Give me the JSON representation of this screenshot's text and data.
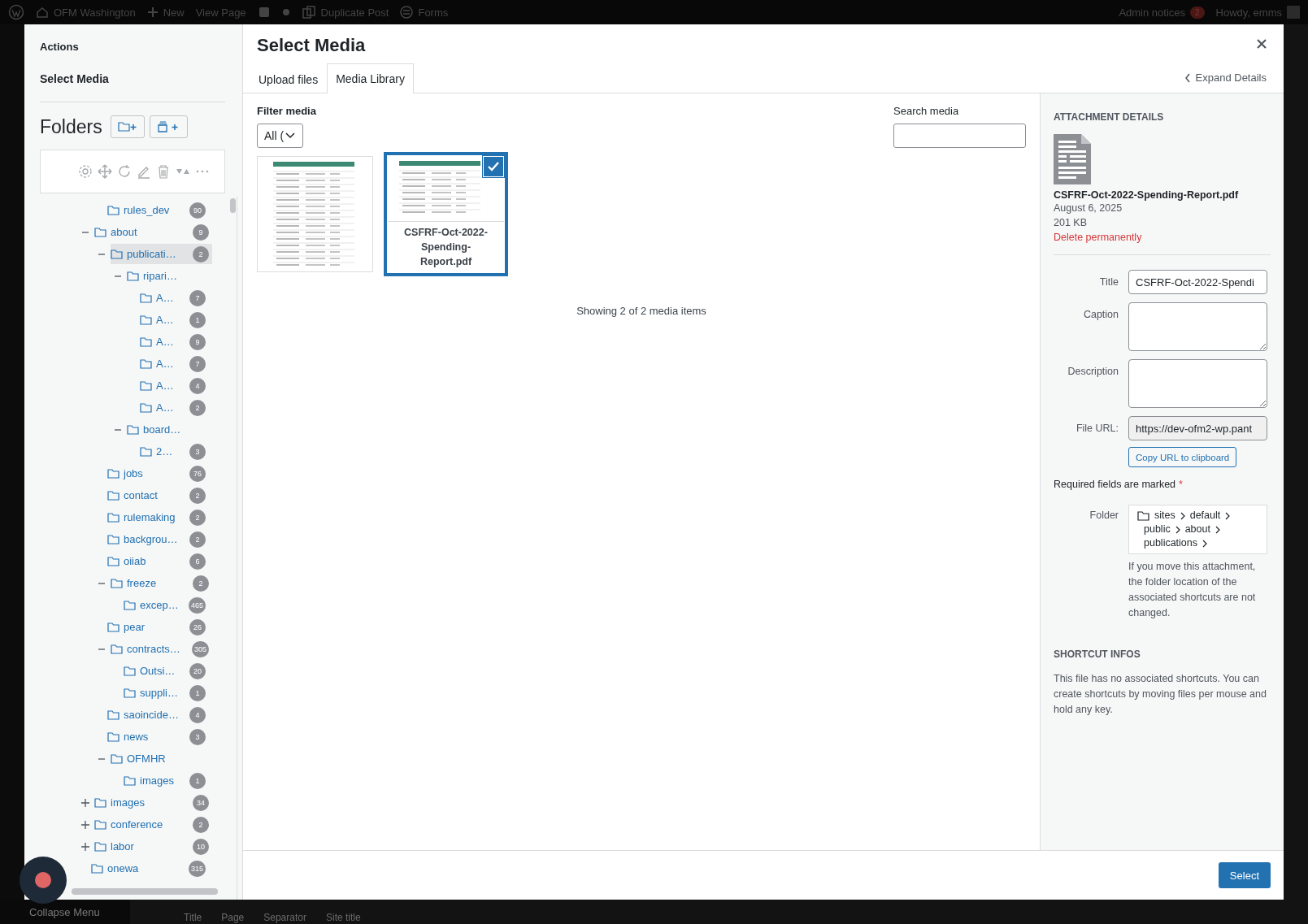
{
  "admin_bar": {
    "site": "OFM Washington",
    "new": "New",
    "view_page": "View Page",
    "duplicate": "Duplicate Post",
    "forms": "Forms",
    "notices": "Admin notices",
    "notices_count": "2",
    "greeting": "Howdy, emms"
  },
  "background": {
    "collapse_menu": "Collapse Menu",
    "columns": [
      "Title",
      "Page",
      "Separator",
      "Site title"
    ]
  },
  "sidebar": {
    "actions": "Actions",
    "select_media": "Select Media",
    "folders_heading": "Folders",
    "tree": [
      {
        "children": [
          {
            "label": "rules_dev",
            "count": "90",
            "selected": false
          }
        ]
      },
      {
        "label": "about",
        "count": "9",
        "selected": false,
        "expanded": true,
        "children": [
          {
            "label": "publicati…",
            "count": "2",
            "selected": true,
            "expanded": true,
            "children": [
              {
                "label": "ripari…",
                "selected": false,
                "expanded": true,
                "children": [
                  {
                    "label": "A…",
                    "count": "7",
                    "selected": false
                  },
                  {
                    "label": "A…",
                    "count": "1",
                    "selected": false
                  },
                  {
                    "label": "A…",
                    "count": "9",
                    "selected": false
                  },
                  {
                    "label": "A…",
                    "count": "7",
                    "selected": false
                  },
                  {
                    "label": "A…",
                    "count": "4",
                    "selected": false
                  },
                  {
                    "label": "A…",
                    "count": "2",
                    "selected": false
                  }
                ]
              },
              {
                "label": "board…",
                "selected": false,
                "expanded": true,
                "children": [
                  {
                    "label": "2…",
                    "count": "3",
                    "selected": false
                  }
                ]
              }
            ]
          },
          {
            "label": "jobs",
            "count": "76",
            "selected": false
          },
          {
            "label": "contact",
            "count": "2",
            "selected": false
          },
          {
            "label": "rulemaking",
            "count": "2",
            "selected": false
          },
          {
            "label": "backgrou…",
            "count": "2",
            "selected": false
          },
          {
            "label": "oiiab",
            "count": "6",
            "selected": false
          },
          {
            "label": "freeze",
            "count": "2",
            "selected": false,
            "expanded": true,
            "children": [
              {
                "label": "excep…",
                "count": "465",
                "selected": false
              }
            ]
          },
          {
            "label": "pear",
            "count": "26",
            "selected": false
          },
          {
            "label": "contracts…",
            "count": "305",
            "selected": false,
            "expanded": true,
            "children": [
              {
                "label": "Outsi…",
                "count": "20",
                "selected": false
              },
              {
                "label": "suppli…",
                "count": "1",
                "selected": false
              }
            ]
          },
          {
            "label": "saoincide…",
            "count": "4",
            "selected": false
          },
          {
            "label": "news",
            "count": "3",
            "selected": false
          },
          {
            "label": "OFMHR",
            "selected": false,
            "expanded": true,
            "children": [
              {
                "label": "images",
                "count": "1",
                "selected": false
              }
            ]
          }
        ]
      },
      {
        "label": "images",
        "count": "34",
        "selected": false,
        "expanded": false
      },
      {
        "label": "conference",
        "count": "2",
        "selected": false,
        "expanded": false
      },
      {
        "label": "labor",
        "count": "10",
        "selected": false,
        "expanded": false
      },
      {
        "label": "onewa",
        "count": "315",
        "selected": false
      }
    ]
  },
  "modal": {
    "title": "Select Media",
    "tabs": [
      {
        "label": "Upload files",
        "selected": false
      },
      {
        "label": "Media Library",
        "selected": true
      }
    ],
    "expand_details": "Expand Details",
    "filter_label": "Filter media",
    "filter_value": "All (",
    "search_label": "Search media",
    "media": [
      {
        "selected": false
      },
      {
        "selected": true,
        "filename": "CSFRF-Oct-2022-Spending-Report.pdf"
      }
    ],
    "count_text": "Showing 2 of 2 media items",
    "select_button": "Select"
  },
  "details": {
    "heading": "ATTACHMENT DETAILS",
    "filename": "CSFRF-Oct-2022-Spending-Report.pdf",
    "date": "August 6, 2025",
    "size": "201 KB",
    "delete": "Delete permanently",
    "fields": [
      {
        "kind": "text",
        "label": "Title",
        "value": "CSFRF-Oct-2022-Spendi"
      },
      {
        "kind": "textarea",
        "label": "Caption"
      },
      {
        "kind": "textarea",
        "label": "Description"
      },
      {
        "kind": "readonly",
        "label": "File URL:",
        "value": "https://dev-ofm2-wp.pant"
      }
    ],
    "copy_button": "Copy URL to clipboard",
    "required_note": "Required fields are marked",
    "required_mark": "*",
    "folder_label": "Folder",
    "folder_path": [
      "sites",
      "default",
      "public",
      "about",
      "publications"
    ],
    "folder_note": "If you move this attachment, the folder location of the associated shortcuts are not changed.",
    "shortcut_heading": "SHORTCUT INFOS",
    "shortcut_text": "This file has no associated shortcuts. You can create shortcuts by moving files per mouse and hold any key."
  }
}
